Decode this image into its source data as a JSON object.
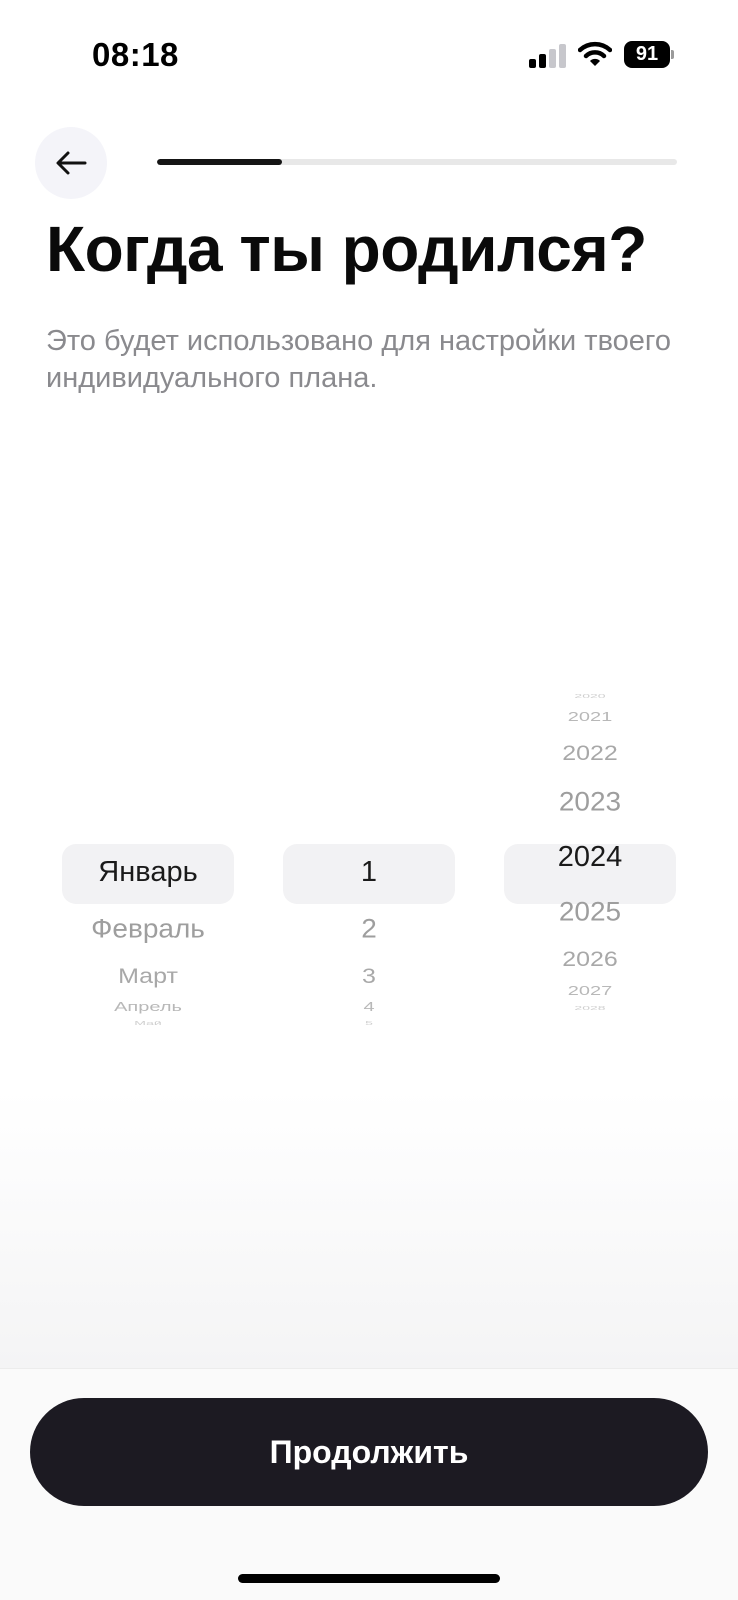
{
  "status_bar": {
    "time": "08:18",
    "battery_level": "91",
    "signal_bars_active": 2,
    "signal_bars_total": 4
  },
  "header": {
    "back_icon": "arrow-left-icon",
    "progress_fraction": 0.24
  },
  "title": "Когда ты родился?",
  "subtitle": "Это будет использовано для настройки твоего индивидуального плана.",
  "date_picker": {
    "months": [
      "Январь",
      "Февраль",
      "Март",
      "Апрель",
      "Май"
    ],
    "days": [
      "1",
      "2",
      "3",
      "4",
      "5"
    ],
    "years_above": [
      "2020",
      "2021",
      "2022",
      "2023"
    ],
    "years_below": [
      "2025",
      "2026",
      "2027",
      "2028"
    ],
    "selected": {
      "month": "Январь",
      "day": "1",
      "year": "2024"
    }
  },
  "continue_label": "Продолжить",
  "colors": {
    "primary_button": "#1c1a22",
    "progress_fill": "#151515",
    "progress_track": "#e8e8e8",
    "subtitle": "#8a8a8e",
    "picker_highlight": "#f2f2f4"
  }
}
